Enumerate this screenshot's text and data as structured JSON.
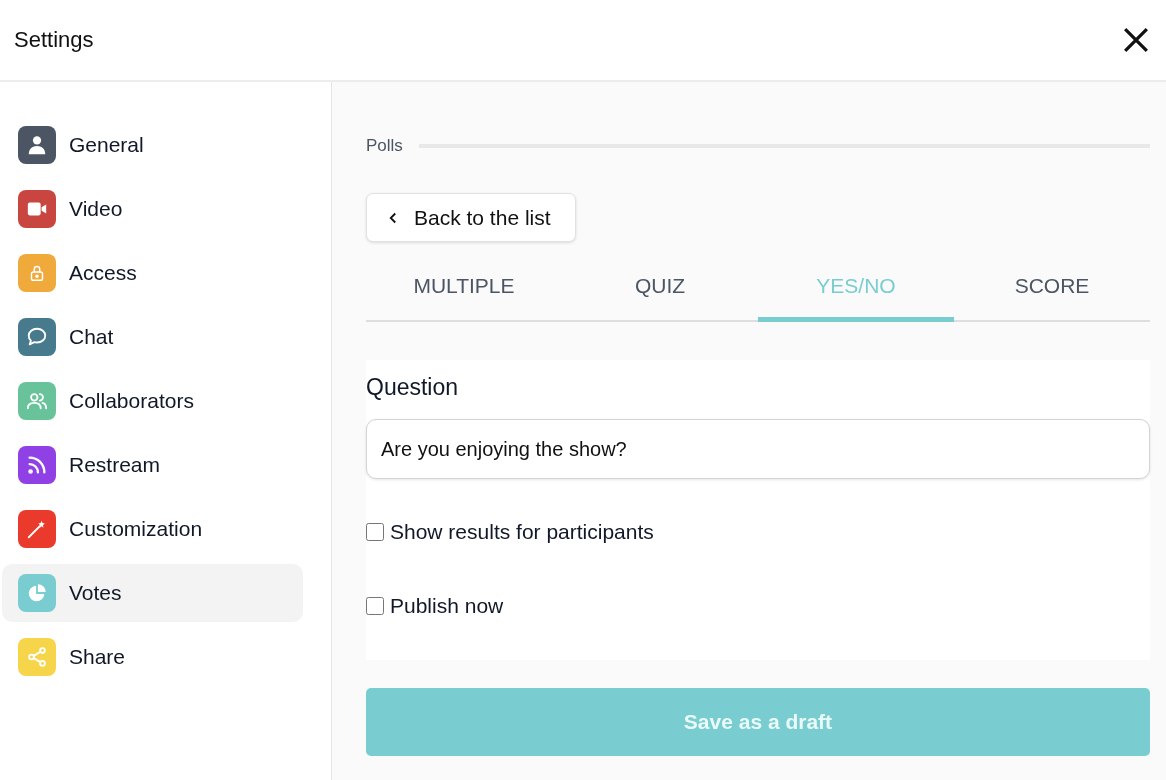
{
  "window": {
    "title": "Settings"
  },
  "sidebar": {
    "items": [
      {
        "label": "General",
        "kind": "person",
        "color": "#4b5563",
        "selected": false
      },
      {
        "label": "Video",
        "kind": "video",
        "color": "#c9453f",
        "selected": false
      },
      {
        "label": "Access",
        "kind": "lock",
        "color": "#f0a93b",
        "selected": false
      },
      {
        "label": "Chat",
        "kind": "chat",
        "color": "#467a8c",
        "selected": false
      },
      {
        "label": "Collaborators",
        "kind": "people",
        "color": "#69c39a",
        "selected": false
      },
      {
        "label": "Restream",
        "kind": "rss",
        "color": "#9041e6",
        "selected": false
      },
      {
        "label": "Customization",
        "kind": "wand",
        "color": "#e93a2b",
        "selected": false
      },
      {
        "label": "Votes",
        "kind": "pie",
        "color": "#79cdd0",
        "selected": true
      },
      {
        "label": "Share",
        "kind": "share",
        "color": "#f7d54a",
        "selected": false
      }
    ]
  },
  "section": {
    "title": "Polls"
  },
  "back_button": {
    "label": "Back to the list"
  },
  "tabs": [
    {
      "label": "MULTIPLE",
      "selected": false
    },
    {
      "label": "QUIZ",
      "selected": false
    },
    {
      "label": "YES/NO",
      "selected": true
    },
    {
      "label": "SCORE",
      "selected": false
    }
  ],
  "form": {
    "question_label": "Question",
    "question_value": "Are you enjoying the show?",
    "options": [
      {
        "label": "Show results for participants",
        "checked": false
      },
      {
        "label": "Publish now",
        "checked": false
      }
    ]
  },
  "save_button": {
    "label": "Save as a draft",
    "disabled": true
  }
}
